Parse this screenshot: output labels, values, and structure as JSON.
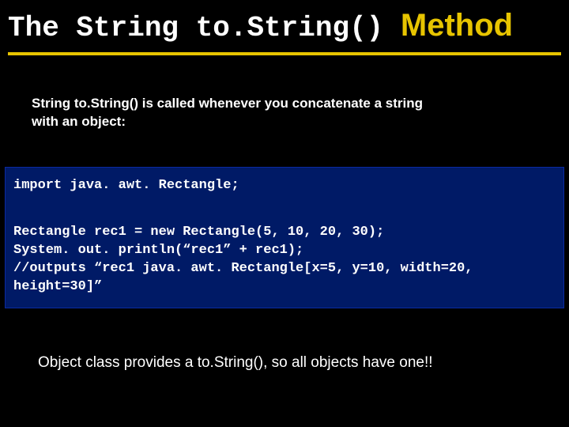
{
  "title": {
    "part1": "The String to.String()",
    "part2": "Method"
  },
  "lead": "String to.String() is called whenever you concatenate a string with an object:",
  "code": {
    "line1": "import java. awt. Rectangle;",
    "line2": "Rectangle rec1 = new Rectangle(5, 10, 20, 30);",
    "line3": "System. out. println(“rec1” + rec1);",
    "line4": "//outputs “rec1 java. awt. Rectangle[x=5, y=10, width=20, height=30]”"
  },
  "footer": "Object class provides a to.String(),  so  all objects have one!!"
}
